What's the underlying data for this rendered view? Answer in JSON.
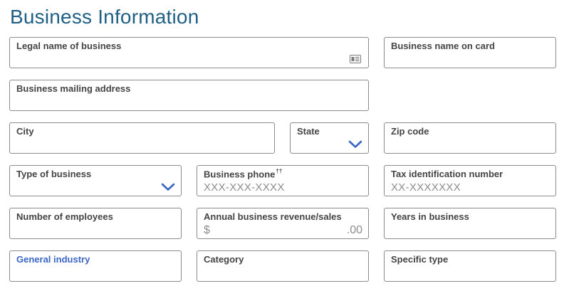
{
  "page": {
    "title": "Business Information"
  },
  "fields": {
    "legal_name": {
      "label": "Legal name of business",
      "icon": "id-card-icon"
    },
    "name_on_card": {
      "label": "Business name on card"
    },
    "mailing_address": {
      "label": "Business mailing address"
    },
    "city": {
      "label": "City"
    },
    "state": {
      "label": "State",
      "icon": "chevron-down-icon"
    },
    "zip": {
      "label": "Zip code"
    },
    "business_type": {
      "label": "Type of business",
      "icon": "chevron-down-icon"
    },
    "business_phone": {
      "label": "Business phone",
      "footnote": "††",
      "placeholder": "XXX-XXX-XXXX"
    },
    "tax_id": {
      "label": "Tax identification number",
      "placeholder": "XX-XXXXXXX"
    },
    "employees": {
      "label": "Number of employees"
    },
    "revenue": {
      "label": "Annual business revenue/sales",
      "prefix": "$",
      "suffix": ".00"
    },
    "years": {
      "label": "Years in business"
    },
    "industry": {
      "label": "General industry"
    },
    "category": {
      "label": "Category"
    },
    "specific_type": {
      "label": "Specific type"
    }
  },
  "colors": {
    "title": "#1f5f86",
    "accent": "#3a66c4",
    "border": "#8b8b8b",
    "label": "#444444",
    "placeholder": "#8c8c8c"
  }
}
